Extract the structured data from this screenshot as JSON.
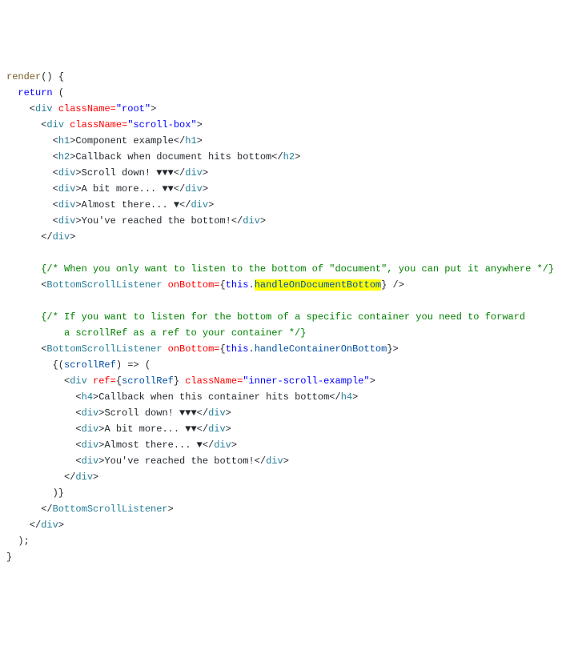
{
  "code": {
    "l1_a": "render",
    "l1_b": "() {",
    "l2_a": "  ",
    "l2_b": "return",
    "l2_c": " (",
    "l3_a": "    <",
    "l3_tag": "div",
    "l3_sp": " ",
    "l3_attr": "className=",
    "l3_str": "\"root\"",
    "l3_close": ">",
    "l4_a": "      <",
    "l4_tag": "div",
    "l4_attr": "className=",
    "l4_str": "\"scroll-box\"",
    "l5_a": "        <",
    "l5_tag": "h1",
    "l5_text": "Component example",
    "l5_ctag": "h1",
    "l6_tag": "h2",
    "l6_text": "Callback when document hits bottom",
    "l7_tag": "div",
    "l7_text": "Scroll down! ▼▼▼",
    "l8_text": "A bit more... ▼▼",
    "l9_text": "Almost there... ▼",
    "l10_text": "You've reached the bottom!",
    "l11_close": "      </",
    "cmt1": "{/* When you only want to listen to the bottom of \"document\", you can put it anywhere */}",
    "bsl_tag": "BottomScrollListener",
    "bsl_attr": "onBottom=",
    "bsl_this": "this",
    "bsl_dot": ".",
    "bsl_handler1": "handleOnDocumentBottom",
    "bsl_selfclose": " />",
    "cmt2a": "{/* If you want to listen for the bottom of a specific container you need to forward",
    "cmt2b": "          a scrollRef as a ref to your container */}",
    "bsl2_handler": "handleContainerOnBottom",
    "arrow_open": "        {(",
    "arrow_var": "scrollRef",
    "arrow_mid": ") => (",
    "inner_div_open": "          <",
    "inner_ref_attr": "ref=",
    "inner_ref_expr_open": "{",
    "inner_ref_expr": "scrollRef",
    "inner_ref_expr_close": "}",
    "inner_cls_attr": "className=",
    "inner_cls_str": "\"inner-scroll-example\"",
    "inner_h4_tag": "h4",
    "inner_h4_text": "Callback when this container hits bottom",
    "close_div_inner": "          </",
    "arrow_close": "        )}",
    "bsl_close": "      </",
    "outer_div_close": "    </",
    "paren_close": "  );",
    "brace_close": "}"
  }
}
